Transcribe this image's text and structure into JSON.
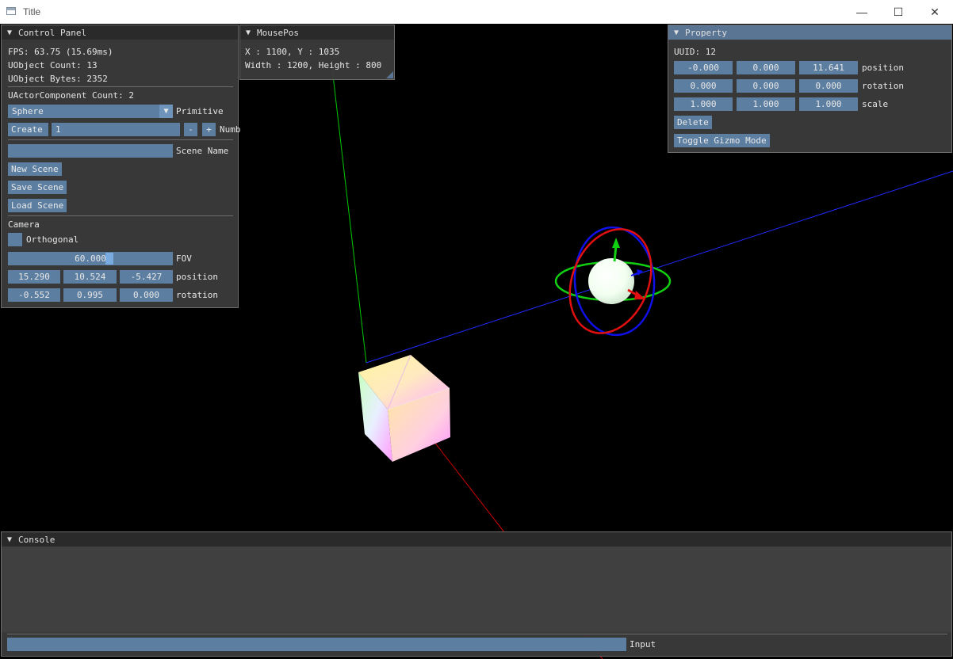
{
  "window": {
    "title": "Title",
    "minimize": "—",
    "maximize": "☐",
    "close": "✕"
  },
  "control_panel": {
    "title": "Control Panel",
    "fps": "FPS: 63.75 (15.69ms)",
    "uobject_count": "UObject Count: 13",
    "uobject_bytes": "UObject Bytes: 2352",
    "uactor_component_count": "UActorComponent Count: 2",
    "primitive_value": "Sphere",
    "primitive_label": "Primitive",
    "create_label": "Create",
    "number_value": "1",
    "minus_label": "-",
    "plus_label": "+",
    "number_label": "Numb",
    "scene_name_value": "",
    "scene_name_label": "Scene Name",
    "new_scene": "New Scene",
    "save_scene": "Save Scene",
    "load_scene": "Load Scene",
    "camera_header": "Camera",
    "orthogonal_label": "Orthogonal",
    "orthogonal_checked": false,
    "fov_value": "60.000",
    "fov_label": "FOV",
    "position": [
      "15.290",
      "10.524",
      "-5.427"
    ],
    "position_label": "position",
    "rotation": [
      "-0.552",
      "0.995",
      "0.000"
    ],
    "rotation_label": "rotation"
  },
  "mouse_pos": {
    "title": "MousePos",
    "coords": "X : 1100, Y : 1035",
    "size": "Width : 1200, Height : 800"
  },
  "property": {
    "title": "Property",
    "uuid": "UUID: 12",
    "position": [
      "-0.000",
      "0.000",
      "11.641"
    ],
    "position_label": "position",
    "rotation": [
      "0.000",
      "0.000",
      "0.000"
    ],
    "rotation_label": "rotation",
    "scale": [
      "1.000",
      "1.000",
      "1.000"
    ],
    "scale_label": "scale",
    "delete": "Delete",
    "toggle_gizmo": "Toggle Gizmo Mode"
  },
  "console": {
    "title": "Console",
    "input_value": "",
    "input_label": "Input"
  },
  "colors": {
    "panel_bg": "#3a3a3a",
    "header_bg": "#2a2a2a",
    "header_active": "#5a7594",
    "widget": "#5c7ea0",
    "axis_x": "#ff0000",
    "axis_y": "#00ff00",
    "axis_z": "#0000ff"
  }
}
